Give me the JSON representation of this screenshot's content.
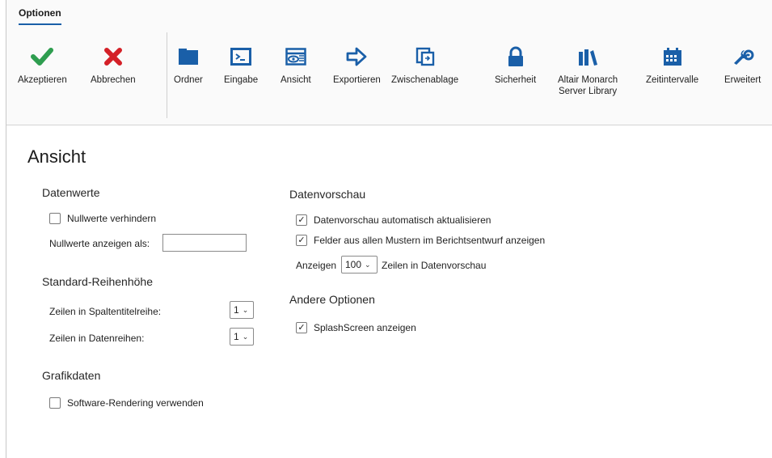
{
  "ribbon": {
    "tab_label": "Optionen",
    "buttons": [
      {
        "label": "Akzeptieren",
        "icon": "check-icon",
        "color": "#2e9d4f"
      },
      {
        "label": "Abbrechen",
        "icon": "x-icon",
        "color": "#d42027"
      },
      {
        "label": "Ordner",
        "icon": "folder-icon",
        "color": "#1a5fa8"
      },
      {
        "label": "Eingabe",
        "icon": "terminal-icon",
        "color": "#1a5fa8"
      },
      {
        "label": "Ansicht",
        "icon": "eye-window-icon",
        "color": "#1a5fa8"
      },
      {
        "label": "Exportieren",
        "icon": "arrow-right-icon",
        "color": "#1a5fa8"
      },
      {
        "label": "Zwischenablage",
        "icon": "clipboard-icon",
        "color": "#1a5fa8"
      },
      {
        "label": "Sicherheit",
        "icon": "lock-icon",
        "color": "#1a5fa8"
      },
      {
        "label_line1": "Altair Monarch",
        "label_line2": "Server Library",
        "icon": "library-books-icon",
        "color": "#1a5fa8"
      },
      {
        "label": "Zeitintervalle",
        "icon": "calendar-icon",
        "color": "#1a5fa8"
      },
      {
        "label": "Erweitert",
        "icon": "wrench-gear-icon",
        "color": "#1a5fa8"
      }
    ]
  },
  "page": {
    "title": "Ansicht",
    "datenwerte": {
      "heading": "Datenwerte",
      "null_prevent_label": "Nullwerte verhindern",
      "null_prevent_checked": false,
      "null_display_label": "Nullwerte anzeigen als:",
      "null_display_value": ""
    },
    "reihenhoehe": {
      "heading": "Standard-Reihenhöhe",
      "header_rows_label": "Zeilen in Spaltentitelreihe:",
      "header_rows_value": "1",
      "data_rows_label": "Zeilen in Datenreihen:",
      "data_rows_value": "1"
    },
    "grafikdaten": {
      "heading": "Grafikdaten",
      "software_rendering_label": "Software-Rendering verwenden",
      "software_rendering_checked": false
    },
    "datenvorschau": {
      "heading": "Datenvorschau",
      "auto_update_label": "Datenvorschau automatisch aktualisieren",
      "auto_update_checked": true,
      "all_fields_label": "Felder aus allen Mustern im Berichtsentwurf anzeigen",
      "all_fields_checked": true,
      "show_prefix": "Anzeigen",
      "show_value": "100",
      "show_suffix": "Zeilen in Datenvorschau"
    },
    "andere": {
      "heading": "Andere Optionen",
      "splash_label": "SplashScreen anzeigen",
      "splash_checked": true
    }
  }
}
